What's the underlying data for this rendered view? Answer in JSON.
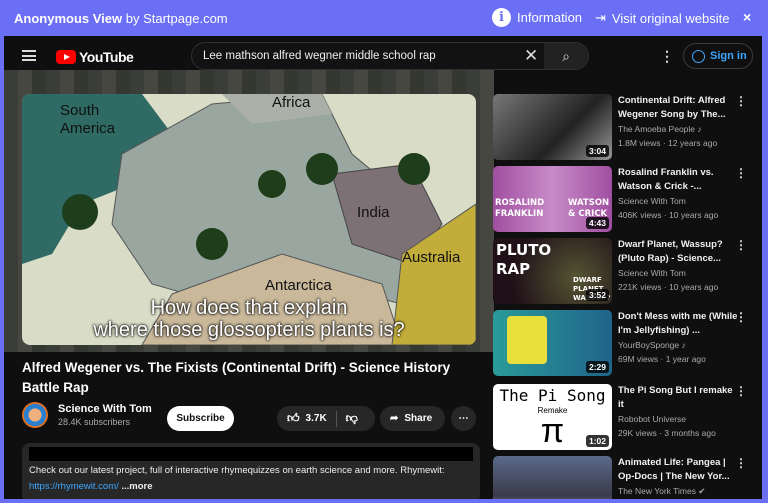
{
  "topbar": {
    "brand_bold": "Anonymous View",
    "brand_rest": " by Startpage.com",
    "information": "Information",
    "visit": "Visit original website",
    "close": "×"
  },
  "header": {
    "logo": "YouTube",
    "search_value": "Lee mathson alfred wegner middle school rap",
    "sign_in": "Sign in"
  },
  "video": {
    "map_labels": {
      "south_america": "South America",
      "africa": "Africa",
      "india": "India",
      "antarctica": "Antarctica",
      "australia": "Australia"
    },
    "caption_line1": "How does that explain",
    "caption_line2": "where those glossopteris plants is?",
    "title": "Alfred Wegener vs. The Fixists (Continental Drift) - Science History Battle Rap",
    "channel": "Science With Tom",
    "subscribers": "28.4K subscribers",
    "subscribe": "Subscribe",
    "likes": "3.7K",
    "share": "Share",
    "description": "Check out our latest project, full of interactive rhymequizzes on earth science and more. Rhymewit:",
    "link": "https://rhymewit.com/",
    "more": " ...more"
  },
  "related": [
    {
      "title": "Continental Drift: Alfred Wegener Song by The...",
      "channel": "The Amoeba People ♪",
      "meta": "1.8M views · 12 years ago",
      "duration": "3:04"
    },
    {
      "title": "Rosalind Franklin vs. Watson & Crick -...",
      "channel": "Science With Tom",
      "meta": "406K views · 10 years ago",
      "duration": "4:43",
      "thumb_text": [
        "ROSALIND FRANKLIN",
        "WATSON & CRICK"
      ]
    },
    {
      "title": "Dwarf Planet, Wassup? (Pluto Rap) - Science...",
      "channel": "Science With Tom",
      "meta": "221K views · 10 years ago",
      "duration": "3:52",
      "thumb_text": [
        "PLUTO RAP",
        "DWARF PLANET WASSUP?"
      ]
    },
    {
      "title": "Don't Mess with me (While I'm Jellyfishing) ...",
      "channel": "YourBoySponge ♪",
      "meta": "69M views · 1 year ago",
      "duration": "2:29"
    },
    {
      "title": "The Pi Song But I remake it",
      "channel": "Robobot Universe",
      "meta": "29K views · 3 months ago",
      "duration": "1:02",
      "thumb_text": [
        "The Pi Song",
        "Remake",
        "π"
      ]
    },
    {
      "title": "Animated Life: Pangea | Op-Docs | The New Yor...",
      "channel": "The New York Times ✔",
      "meta": "",
      "duration": ""
    }
  ]
}
